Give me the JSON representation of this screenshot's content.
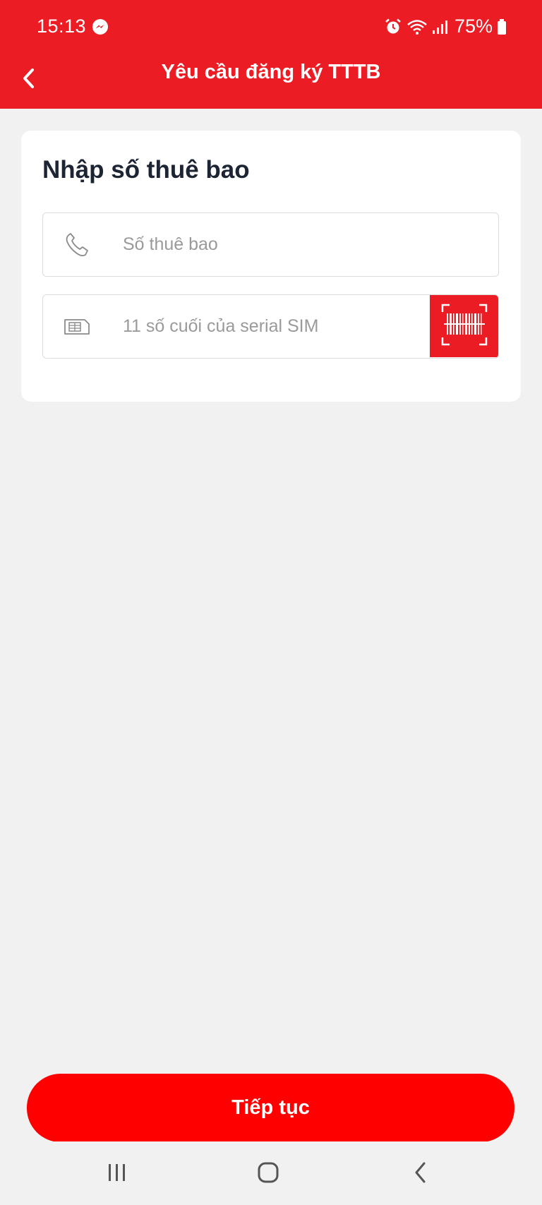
{
  "status_bar": {
    "time": "15:13",
    "battery": "75%"
  },
  "header": {
    "title": "Yêu cầu đăng ký TTTB"
  },
  "card": {
    "title": "Nhập số thuê bao",
    "phone_field": {
      "placeholder": "Số thuê bao",
      "value": "",
      "icon": "phone-icon"
    },
    "sim_field": {
      "placeholder": "11 số cuối của serial SIM",
      "value": "",
      "icon": "sim-card-icon",
      "action_icon": "barcode-scan-icon"
    }
  },
  "footer": {
    "continue_label": "Tiếp tục"
  },
  "colors": {
    "brand_red": "#ec1c24",
    "button_red": "#ff0000",
    "background": "#f1f1f1",
    "title_text": "#1d2433",
    "placeholder_text": "#9a9a9a"
  }
}
